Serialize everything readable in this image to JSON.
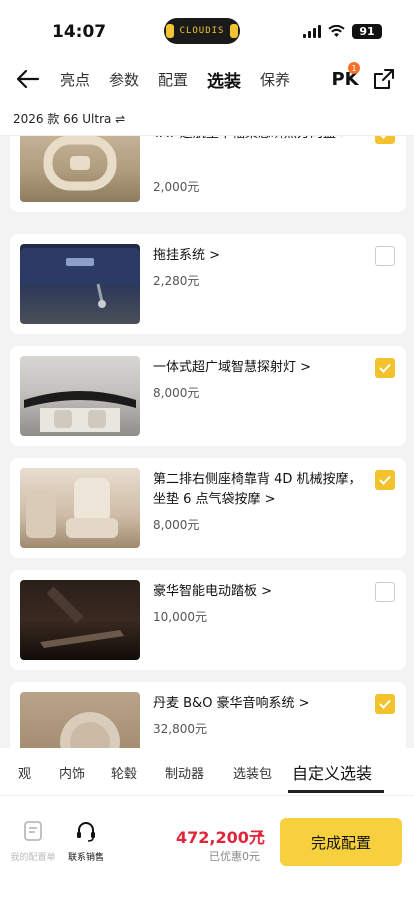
{
  "status_bar": {
    "time": "14:07",
    "island_text": "CLOUDIS",
    "battery": "91"
  },
  "nav": {
    "tabs": [
      "亮点",
      "参数",
      "配置",
      "选装",
      "保养"
    ],
    "active_tab": "选装",
    "pk_label": "PK",
    "pk_badge": "1"
  },
  "model": {
    "label": "2026 款 66 Ultra ⇌"
  },
  "options": [
    {
      "title": "YAT 巡航型半幅柔感瞬热方向盘 >",
      "price": "2,000元",
      "checked": true,
      "icon": "steering-wheel"
    },
    {
      "title": "拖挂系统 >",
      "price": "2,280元",
      "checked": false,
      "icon": "tow-hitch"
    },
    {
      "title": "一体式超广域智慧探射灯 >",
      "price": "8,000元",
      "checked": true,
      "icon": "roof-light"
    },
    {
      "title": "第二排右侧座椅靠背 4D 机械按摩，坐垫 6 点气袋按摩 >",
      "price": "8,000元",
      "checked": true,
      "icon": "massage-seat"
    },
    {
      "title": "豪华智能电动踏板 >",
      "price": "10,000元",
      "checked": false,
      "icon": "running-board"
    },
    {
      "title": "丹麦 B&O 豪华音响系统 >",
      "price": "32,800元",
      "checked": true,
      "icon": "speaker"
    }
  ],
  "categories": [
    "观",
    "内饰",
    "轮毂",
    "制动器",
    "选装包",
    "自定义选装"
  ],
  "active_category": "自定义选装",
  "bottom": {
    "my_config_label": "我的配置单",
    "sales_label": "联系销售",
    "total_price": "472,200元",
    "discount": "已优惠0元",
    "finish_label": "完成配置"
  },
  "colors": {
    "accent": "#f6d13d",
    "checkbox": "#f3c22c",
    "price": "#e0263b"
  }
}
